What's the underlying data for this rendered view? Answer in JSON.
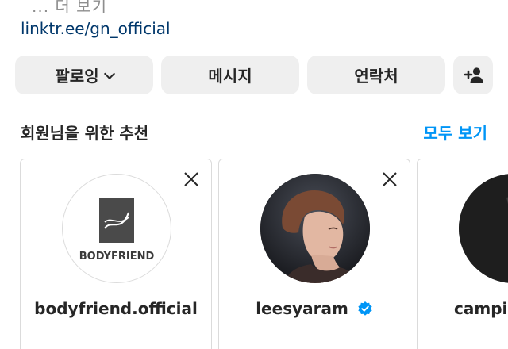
{
  "bio": {
    "more_text": "... 더 보기",
    "link": "linktr.ee/gn_official"
  },
  "actions": {
    "follow_label": "팔로잉",
    "message_label": "메시지",
    "contact_label": "연락처",
    "add_user_icon": "person-plus-icon"
  },
  "suggested": {
    "title": "회원님을 위한 추천",
    "see_all": "모두 보기",
    "cards": [
      {
        "username": "bodyfriend.official",
        "avatar_text": "BODYFRIEND",
        "verified": false
      },
      {
        "username": "leesyaram",
        "verified": true
      },
      {
        "username": "campin",
        "verified": false
      }
    ]
  },
  "colors": {
    "link": "#00376b",
    "accent": "#0095f6",
    "button_bg": "#efefef",
    "border": "#dbdbdb",
    "verified": "#0095f6"
  }
}
